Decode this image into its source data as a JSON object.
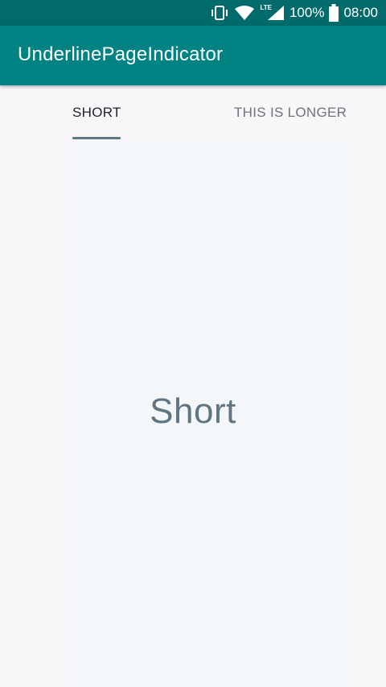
{
  "status_bar": {
    "battery": "100%",
    "time": "08:00",
    "network": "LTE",
    "icons": [
      "vibrate-icon",
      "wifi-icon",
      "signal-icon",
      "battery-icon"
    ]
  },
  "app_bar": {
    "title": "UnderlinePageIndicator"
  },
  "tabs": [
    {
      "label": "SHORT",
      "selected": true
    },
    {
      "label": "THIS IS LONGER",
      "selected": false
    }
  ],
  "page": {
    "content": "Short"
  },
  "colors": {
    "status_bar": "#016b6b",
    "app_bar": "#028383",
    "indicator": "#607680",
    "page_text": "#5f7682"
  }
}
